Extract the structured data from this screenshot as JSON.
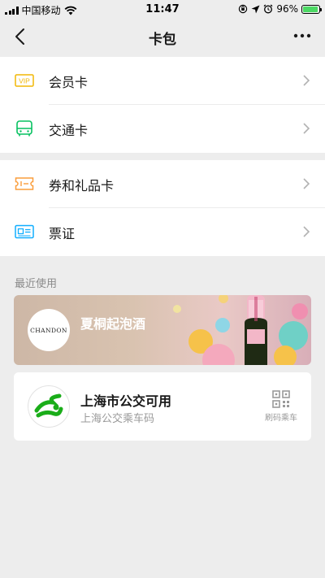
{
  "status_bar": {
    "carrier": "中国移动",
    "time": "11:47",
    "battery_percent": "96%",
    "battery_level": 0.96,
    "icons": [
      "signal-icon",
      "wifi-icon",
      "orientation-lock-icon",
      "location-icon",
      "alarm-icon",
      "battery-icon"
    ]
  },
  "nav": {
    "title": "卡包",
    "back_icon": "chevron-left-icon",
    "more_icon": "more-dots-icon"
  },
  "group1": [
    {
      "label": "会员卡",
      "icon": "vip-icon",
      "icon_text": "VIP",
      "color": "#f2b705"
    },
    {
      "label": "交通卡",
      "icon": "bus-icon",
      "color": "#07c160"
    }
  ],
  "group2": [
    {
      "label": "券和礼品卡",
      "icon": "ticket-icon",
      "color": "#fa9d3b"
    },
    {
      "label": "票证",
      "icon": "id-card-icon",
      "color": "#10aeff"
    }
  ],
  "recent": {
    "section_title": "最近使用",
    "promo": {
      "brand": "CHANDON",
      "name": "夏桐起泡酒"
    },
    "bus_card": {
      "title": "上海市公交可用",
      "subtitle": "上海公交乘车码",
      "action_label": "刷码乘车",
      "action_icon": "qr-code-icon",
      "logo_color": "#1aad19"
    }
  },
  "colors": {
    "background": "#ededed",
    "chevron": "#b2b2b2",
    "accent_green": "#07c160"
  }
}
